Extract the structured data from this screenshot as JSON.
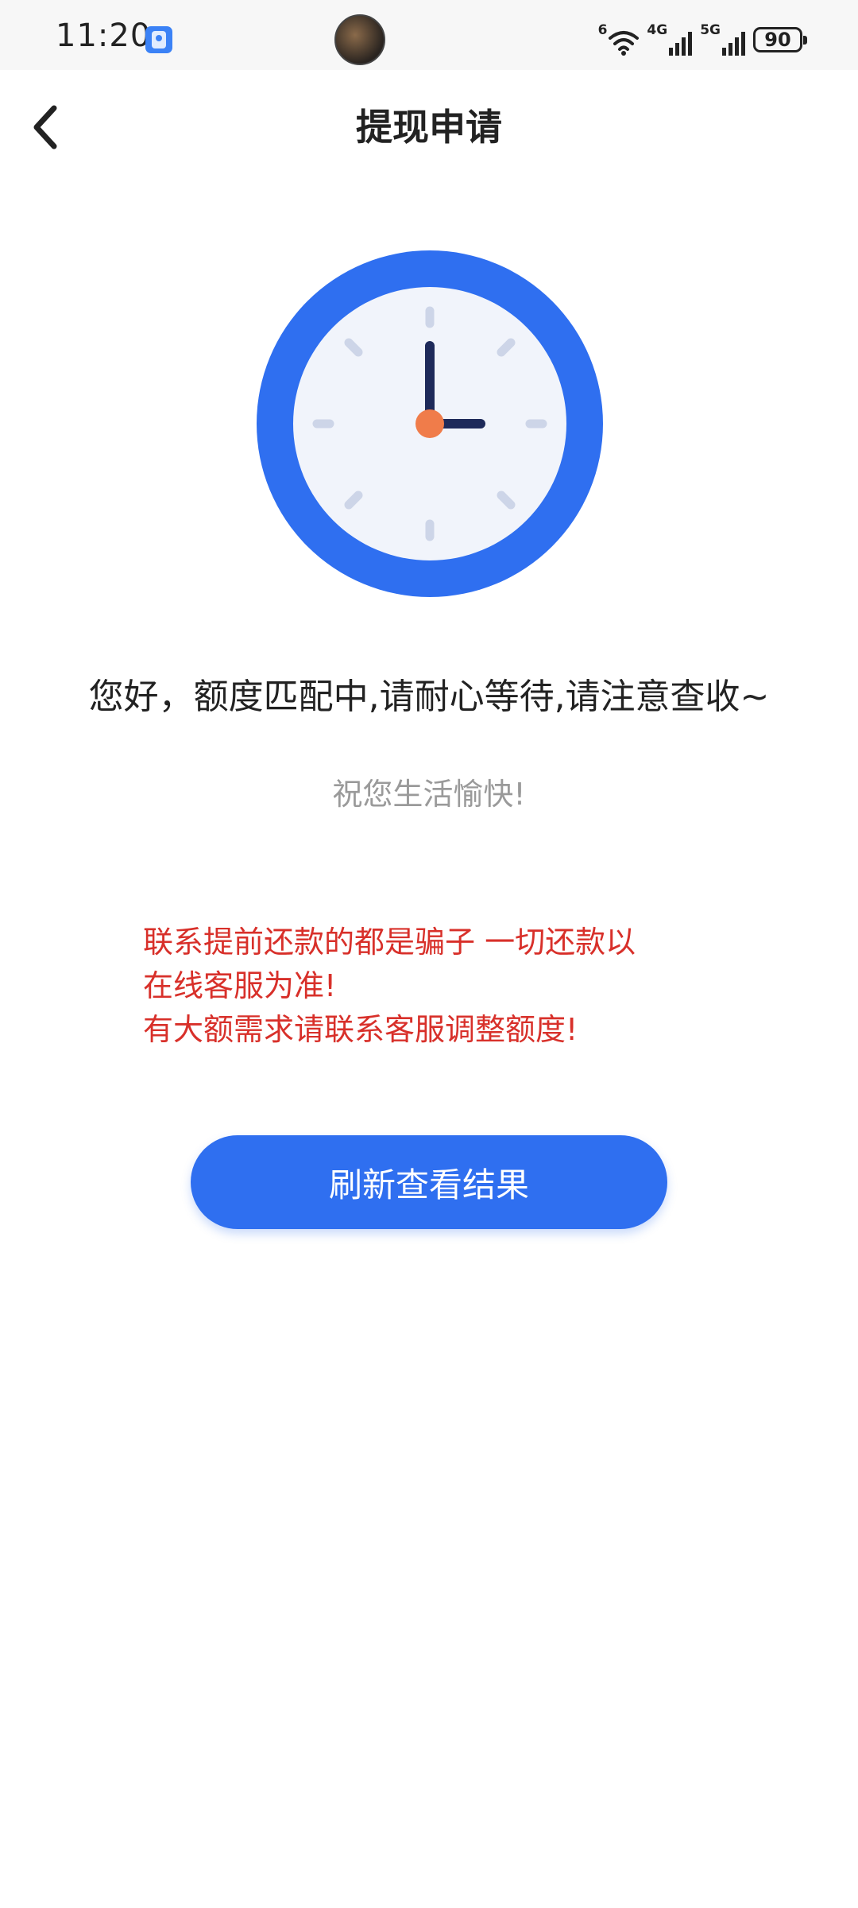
{
  "status_bar": {
    "time": "11:20",
    "wifi_label": "6",
    "network1_label": "4G",
    "network2_label": "5G",
    "battery": "90"
  },
  "header": {
    "title": "提现申请",
    "back_icon": "chevron-left-icon"
  },
  "illustration": {
    "icon": "clock-icon",
    "colors": {
      "ring": "#2f6ff0",
      "face": "#f1f4fb",
      "hands": "#1e2a5a",
      "center": "#f07c4a",
      "ticks": "#cdd5e8"
    }
  },
  "content": {
    "main_message": "您好，额度匹配中,请耐心等待,请注意查收~",
    "sub_message": "祝您生活愉快!",
    "warning_lines": [
      "联系提前还款的都是骗子 一切还款以",
      "在线客服为准!",
      "有大额需求请联系客服调整额度!"
    ],
    "warning_color": "#d8302a"
  },
  "actions": {
    "refresh_label": "刷新查看结果",
    "button_color": "#2f6ff0"
  }
}
